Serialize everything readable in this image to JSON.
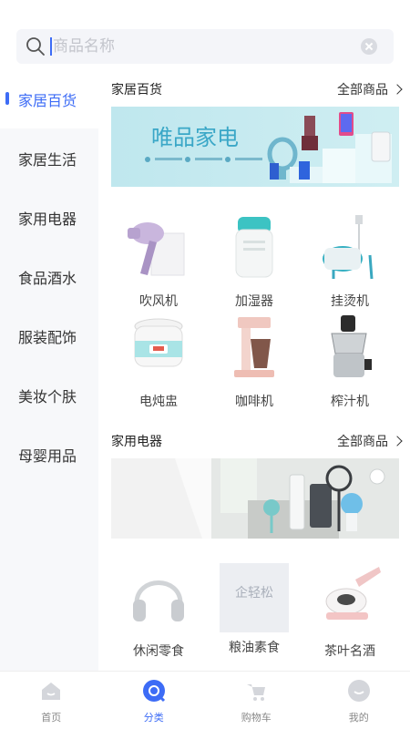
{
  "search": {
    "placeholder": "商品名称"
  },
  "sidebar": {
    "items": [
      {
        "label": "家居百货",
        "active": true
      },
      {
        "label": "家居生活"
      },
      {
        "label": "家用电器"
      },
      {
        "label": "食品酒水"
      },
      {
        "label": "服装配饰"
      },
      {
        "label": "美妆个肤"
      },
      {
        "label": "母婴用品"
      }
    ]
  },
  "sections": [
    {
      "title": "家居百货",
      "more_label": "全部商品",
      "banner_text": "唯品家电",
      "products": [
        {
          "name": "吹风机",
          "icon": "hair-dryer-icon"
        },
        {
          "name": "加湿器",
          "icon": "humidifier-icon"
        },
        {
          "name": "挂烫机",
          "icon": "garment-steamer-icon"
        },
        {
          "name": "电炖盅",
          "icon": "slow-cooker-icon"
        },
        {
          "name": "咖啡机",
          "icon": "coffee-machine-icon"
        },
        {
          "name": "榨汁机",
          "icon": "juicer-icon"
        }
      ]
    },
    {
      "title": "家用电器",
      "more_label": "全部商品",
      "products": [
        {
          "name": "休闲零食",
          "icon": "headphones-icon"
        },
        {
          "name": "粮油素食",
          "icon": "placeholder-logo-icon",
          "logo_text": "企轻松"
        },
        {
          "name": "茶叶名酒",
          "icon": "mite-vacuum-icon"
        }
      ]
    }
  ],
  "tabbar": {
    "items": [
      {
        "label": "首页",
        "icon": "home-icon"
      },
      {
        "label": "分类",
        "icon": "category-icon",
        "active": true
      },
      {
        "label": "购物车",
        "icon": "cart-icon"
      },
      {
        "label": "我的",
        "icon": "profile-icon"
      }
    ]
  },
  "colors": {
    "accent": "#3d6cf6",
    "sidebar_bg": "#f7f8fa",
    "search_bg": "#f4f5f9"
  }
}
